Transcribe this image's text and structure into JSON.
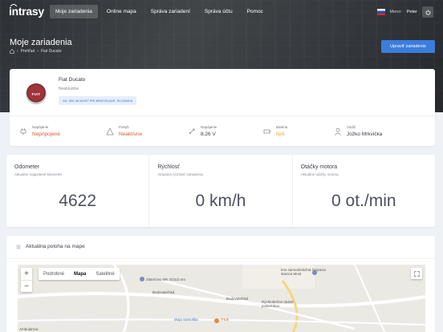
{
  "app": {
    "logo_text": "intrasy",
    "nav": [
      {
        "label": "Moje zariadenia",
        "active": true
      },
      {
        "label": "Online mapa",
        "active": false
      },
      {
        "label": "Správa zariadení",
        "active": false
      },
      {
        "label": "Správa účtu",
        "active": false
      },
      {
        "label": "Pomoc",
        "active": false
      }
    ],
    "user": {
      "prefix": "Meno:",
      "name": "Peter"
    }
  },
  "page": {
    "title": "Moje zariadenia",
    "breadcrumb": [
      "Prehľad",
      "Fiat Ducato"
    ],
    "edit_button": "Upraviť zariadenie"
  },
  "vehicle": {
    "brand_logo_text": "FIAT",
    "name": "Fiat Ducato",
    "state": "Neaktuálne",
    "address": "SD, 900 46 MOST PRI BRATISLAVE, SLOVAKIA",
    "stats": [
      {
        "label": "Napájanie",
        "value": "Nepripojené",
        "icon": "plug-icon",
        "tone": "red"
      },
      {
        "label": "Pohyb",
        "value": "Neaktívne",
        "icon": "triangle-icon",
        "tone": "red"
      },
      {
        "label": "Napájanie",
        "value": "8.26 V",
        "icon": "voltage-icon",
        "tone": "normal"
      },
      {
        "label": "Batéria",
        "value": "N/A",
        "icon": "battery-icon",
        "tone": "orange"
      },
      {
        "label": "Vodič",
        "value": "Jožko Mrkvička",
        "icon": "person-icon",
        "tone": "normal"
      }
    ]
  },
  "metrics": [
    {
      "title": "Odometer",
      "subtitle": "Aktuálne najazdené kilometre",
      "value": "4622"
    },
    {
      "title": "Rýchlosť",
      "subtitle": "Aktuálna rýchlosť zariadenia",
      "value": "0 km/h"
    },
    {
      "title": "Otáčky motora",
      "subtitle": "Aktuálne otáčky motora",
      "value": "0 ot./min"
    }
  ],
  "map": {
    "header": "Aktuálna poloha na mape",
    "types": [
      "Podrobné",
      "Mapa",
      "Satelitné"
    ],
    "active_type": "Mapa",
    "labels": [
      {
        "text": "Zlatníctvo MK GOLD.sro",
        "tone": "normal"
      },
      {
        "text": "tmx samoobslužná čerpacia stanica Most",
        "tone": "normal"
      },
      {
        "text": "Rýchlobežné útulné podielnikov",
        "tone": "normal"
      },
      {
        "text": "Moja Samoška",
        "tone": "blue"
      },
      {
        "text": "Fruk",
        "tone": "orange"
      },
      {
        "text": "Ambulancia",
        "tone": "normal"
      },
      {
        "text": "Budovateľská",
        "tone": "normal"
      },
      {
        "text": "Budovateľská",
        "tone": "normal"
      }
    ]
  },
  "colors": {
    "accent": "#3b7ddd",
    "danger": "#e0563a",
    "warning": "#ef9b2c"
  }
}
